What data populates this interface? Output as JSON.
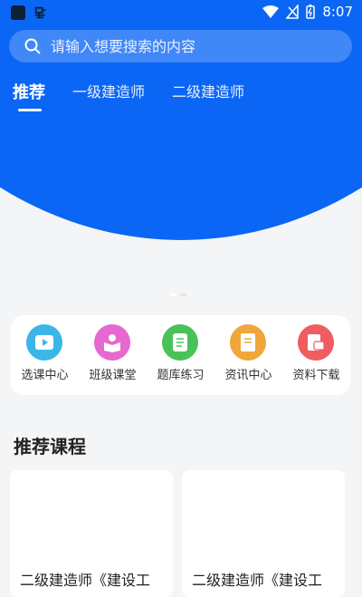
{
  "status": {
    "time": "8:07"
  },
  "search": {
    "placeholder": "请输入想要搜索的内容"
  },
  "tabs": [
    {
      "label": "推荐",
      "active": true
    },
    {
      "label": "一级建造师",
      "active": false
    },
    {
      "label": "二级建造师",
      "active": false
    }
  ],
  "banner": {
    "active_dot": 0,
    "dot_count": 2
  },
  "quick": [
    {
      "label": "选课中心",
      "icon": "video-play-icon",
      "color": "#3cb6e8"
    },
    {
      "label": "班级课堂",
      "icon": "reading-person-icon",
      "color": "#e768d0"
    },
    {
      "label": "题库练习",
      "icon": "scroll-doc-icon",
      "color": "#4ac25a"
    },
    {
      "label": "资讯中心",
      "icon": "book-icon",
      "color": "#f0a63a"
    },
    {
      "label": "资料下载",
      "icon": "file-download-icon",
      "color": "#ef5d60"
    }
  ],
  "section": {
    "title": "推荐课程"
  },
  "courses": [
    {
      "title": "二级建造师《建设工"
    },
    {
      "title": "二级建造师《建设工"
    }
  ],
  "colors": {
    "brand": "#0b66f5",
    "page_bg": "#f4f5f7"
  }
}
